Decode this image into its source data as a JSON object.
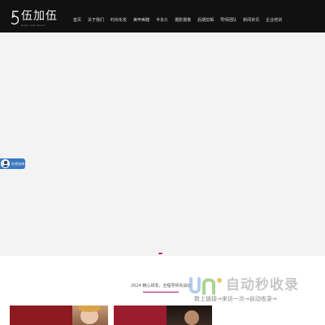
{
  "header": {
    "logo": {
      "name": "伍加伍",
      "subtitle": "wuuu jiaa wuuu",
      "icon": "five-logo-icon"
    },
    "nav": [
      {
        "label": "首页"
      },
      {
        "label": "关于我们"
      },
      {
        "label": "时尚化妆"
      },
      {
        "label": "美甲美睫"
      },
      {
        "label": "半永久"
      },
      {
        "label": "摄影摄像"
      },
      {
        "label": "后期剪辑"
      },
      {
        "label": "导师团队"
      },
      {
        "label": "新闻资讯"
      },
      {
        "label": "企业培训"
      }
    ]
  },
  "banner": {
    "slides": 1,
    "active_slide": 1,
    "accent_color": "#c0208a"
  },
  "consult": {
    "label": "在线咨询",
    "color": "#3b78c3"
  },
  "section": {
    "title": "2024 精心研发，全程导师实战班"
  },
  "cards": [
    {
      "color": "#8c1a1f"
    },
    {
      "color": "#9b1c2c"
    }
  ],
  "watermark": {
    "title": "自动秒收录",
    "subtitle": "数上链接→来访一次→自动收录→"
  }
}
